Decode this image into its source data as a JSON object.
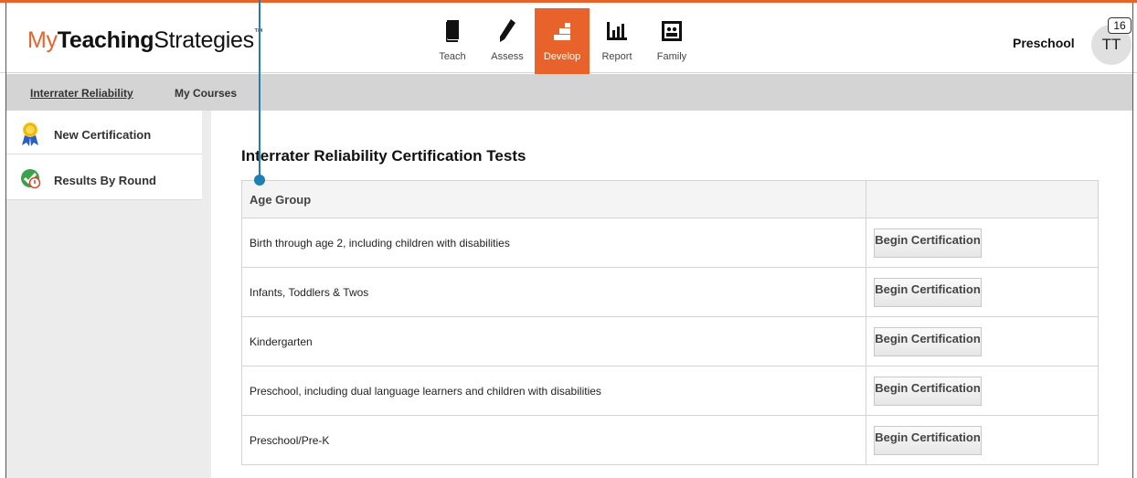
{
  "logo": {
    "part1": "My",
    "part2": "Teaching",
    "part3": "Strategies",
    "tm": "™"
  },
  "nav": [
    {
      "label": "Teach",
      "icon": "book-icon"
    },
    {
      "label": "Assess",
      "icon": "pencil-icon"
    },
    {
      "label": "Develop",
      "icon": "steps-icon",
      "active": true
    },
    {
      "label": "Report",
      "icon": "bar-chart-icon"
    },
    {
      "label": "Family",
      "icon": "family-photo-icon"
    }
  ],
  "header": {
    "program": "Preschool",
    "avatar_initials": "TT",
    "notification_count": "16"
  },
  "subnav": {
    "item1": "Interrater Reliability",
    "item2": "My Courses"
  },
  "sidebar": {
    "items": [
      {
        "label": "New Certification",
        "icon": "award-ribbon-icon"
      },
      {
        "label": "Results By Round",
        "icon": "check-results-icon"
      }
    ]
  },
  "main": {
    "title": "Interrater Reliability Certification Tests",
    "column_header": "Age Group",
    "button_label": "Begin Certification",
    "rows": [
      "Birth through age 2, including children with disabilities",
      "Infants, Toddlers & Twos",
      "Kindergarten",
      "Preschool, including dual language learners and children with disabilities",
      "Preschool/Pre-K"
    ]
  },
  "colors": {
    "accent": "#e8632b",
    "marker": "#1e7fb0"
  }
}
